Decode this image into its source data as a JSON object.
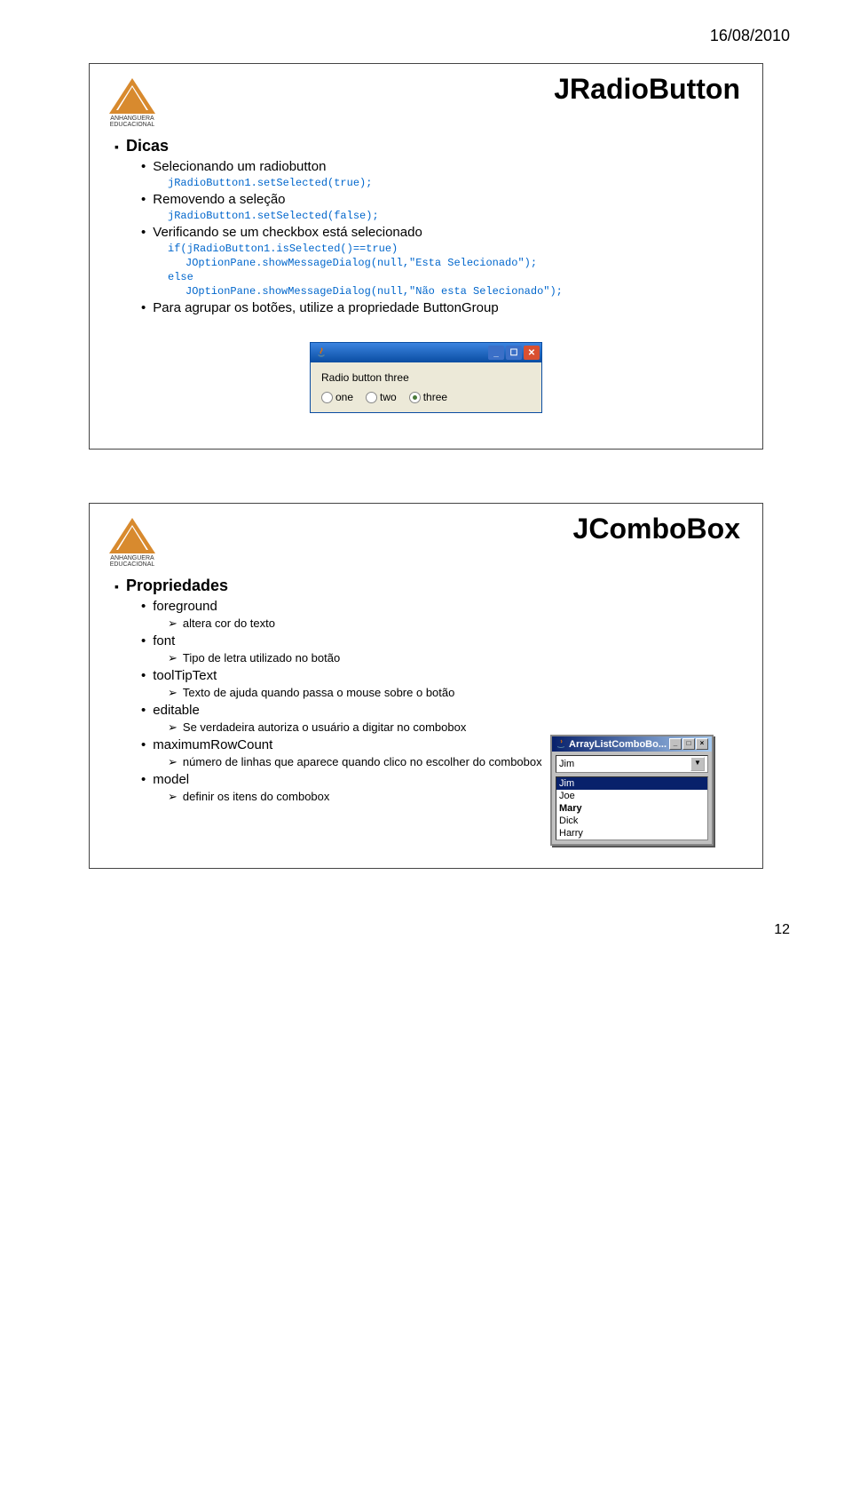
{
  "header_date": "16/08/2010",
  "page_number": "12",
  "logo_text": "ANHANGUERA EDUCACIONAL",
  "slide1": {
    "title": "JRadioButton",
    "h1": "Dicas",
    "b1": "Selecionando um radiobutton",
    "c1": "jRadioButton1.setSelected(true);",
    "b2": "Removendo a seleção",
    "c2": "jRadioButton1.setSelected(false);",
    "b3": "Verificando se um checkbox está selecionado",
    "c3": "if(jRadioButton1.isSelected()==true)",
    "c4": "JOptionPane.showMessageDialog(null,\"Esta Selecionado\");",
    "c5": "else",
    "c6": "JOptionPane.showMessageDialog(null,\"Não esta Selecionado\");",
    "b4": "Para agrupar os botões, utilize a propriedade ButtonGroup",
    "win": {
      "label": "Radio button three",
      "opt1": "one",
      "opt2": "two",
      "opt3": "three"
    }
  },
  "slide2": {
    "title": "JComboBox",
    "h1": "Propriedades",
    "b1": "foreground",
    "d1": "altera cor do texto",
    "b2": "font",
    "d2": "Tipo de letra utilizado no botão",
    "b3": "toolTipText",
    "d3": "Texto de ajuda quando passa o mouse sobre o botão",
    "b4": "editable",
    "d4": "Se verdadeira autoriza o usuário a digitar no combobox",
    "b5": "maximumRowCount",
    "d5": "número de linhas que aparece quando clico no escolher do combobox",
    "b6": "model",
    "d6": "definir os itens do combobox",
    "win": {
      "title": "ArrayListComboBo...",
      "selected": "Jim",
      "items": [
        "Jim",
        "Joe",
        "Mary",
        "Dick",
        "Harry"
      ]
    }
  }
}
